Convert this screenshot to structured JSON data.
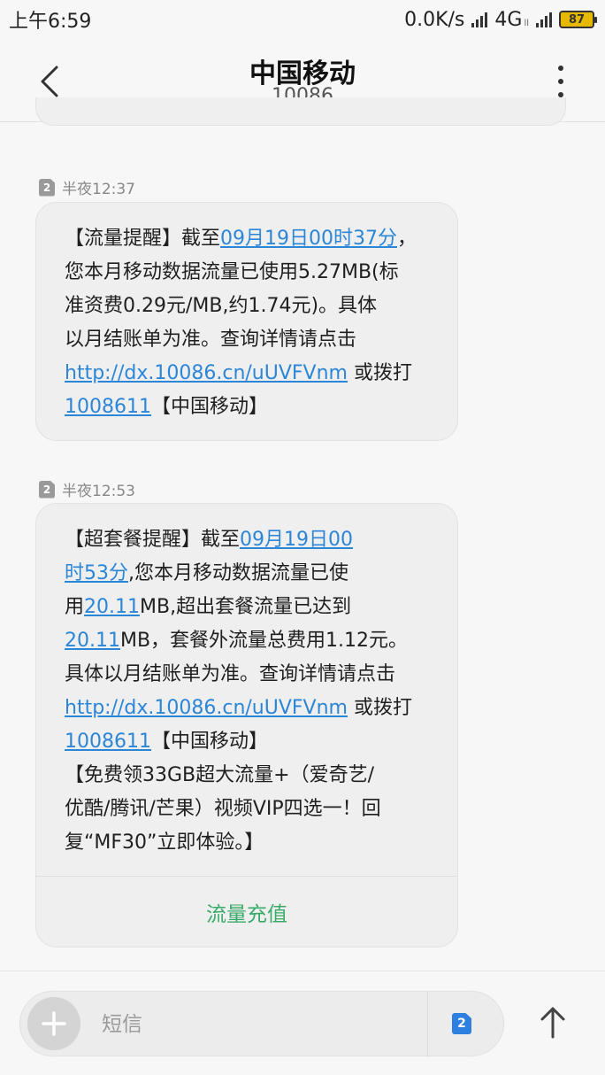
{
  "status_bar": {
    "time": "上午6:59",
    "speed": "0.0K/s",
    "network": "4G",
    "network_sub": "ll",
    "battery": "87"
  },
  "header": {
    "title": "中国移动",
    "subtitle": "10086",
    "back_icon": "chevron-left-icon",
    "menu_icon": "more-vertical-icon"
  },
  "messages": [
    {
      "sim": "2",
      "time": "半夜12:37",
      "lines": [
        [
          {
            "t": "【流量提醒】截至"
          },
          {
            "t": "09月19日00时37分",
            "link": true
          },
          {
            "t": "，"
          }
        ],
        [
          {
            "t": "您本月移动数据流量已使用5.27MB(标"
          }
        ],
        [
          {
            "t": "准资费0.29元/MB,约1.74元)。具体"
          }
        ],
        [
          {
            "t": "以月结账单为准。查询详情请点击"
          }
        ],
        [
          {
            "t": "http://dx.10086.cn/uUVFVnm",
            "link": true
          },
          {
            "t": " 或拨打"
          }
        ],
        [
          {
            "t": "1008611",
            "link": true
          },
          {
            "t": "【中国移动】"
          }
        ]
      ]
    },
    {
      "sim": "2",
      "time": "半夜12:53",
      "lines": [
        [
          {
            "t": "【超套餐提醒】截至"
          },
          {
            "t": "09月19日00",
            "link": true
          }
        ],
        [
          {
            "t": "时53分",
            "link": true
          },
          {
            "t": ",您本月移动数据流量已使"
          }
        ],
        [
          {
            "t": "用"
          },
          {
            "t": "20.11",
            "link": true
          },
          {
            "t": "MB,超出套餐流量已达到"
          }
        ],
        [
          {
            "t": "20.11",
            "link": true
          },
          {
            "t": "MB，套餐外流量总费用1.12元。"
          }
        ],
        [
          {
            "t": "具体以月结账单为准。查询详情请点击"
          }
        ],
        [
          {
            "t": "http://dx.10086.cn/uUVFVnm",
            "link": true
          },
          {
            "t": " 或拨打"
          }
        ],
        [
          {
            "t": "1008611",
            "link": true
          },
          {
            "t": "【中国移动】"
          }
        ],
        [
          {
            "t": "【免费领33GB超大流量+（爱奇艺/"
          }
        ],
        [
          {
            "t": "优酷/腾讯/芒果）视频VIP四选一！回"
          }
        ],
        [
          {
            "t": "复“MF30”立即体验。】"
          }
        ]
      ],
      "action": "流量充值"
    }
  ],
  "composer": {
    "placeholder": "短信",
    "sim": "2",
    "add_icon": "plus-icon",
    "send_icon": "arrow-up-icon"
  },
  "colors": {
    "link": "#2c86d8",
    "action": "#3aaa6a",
    "sim_badge": "#2d7fe0"
  }
}
